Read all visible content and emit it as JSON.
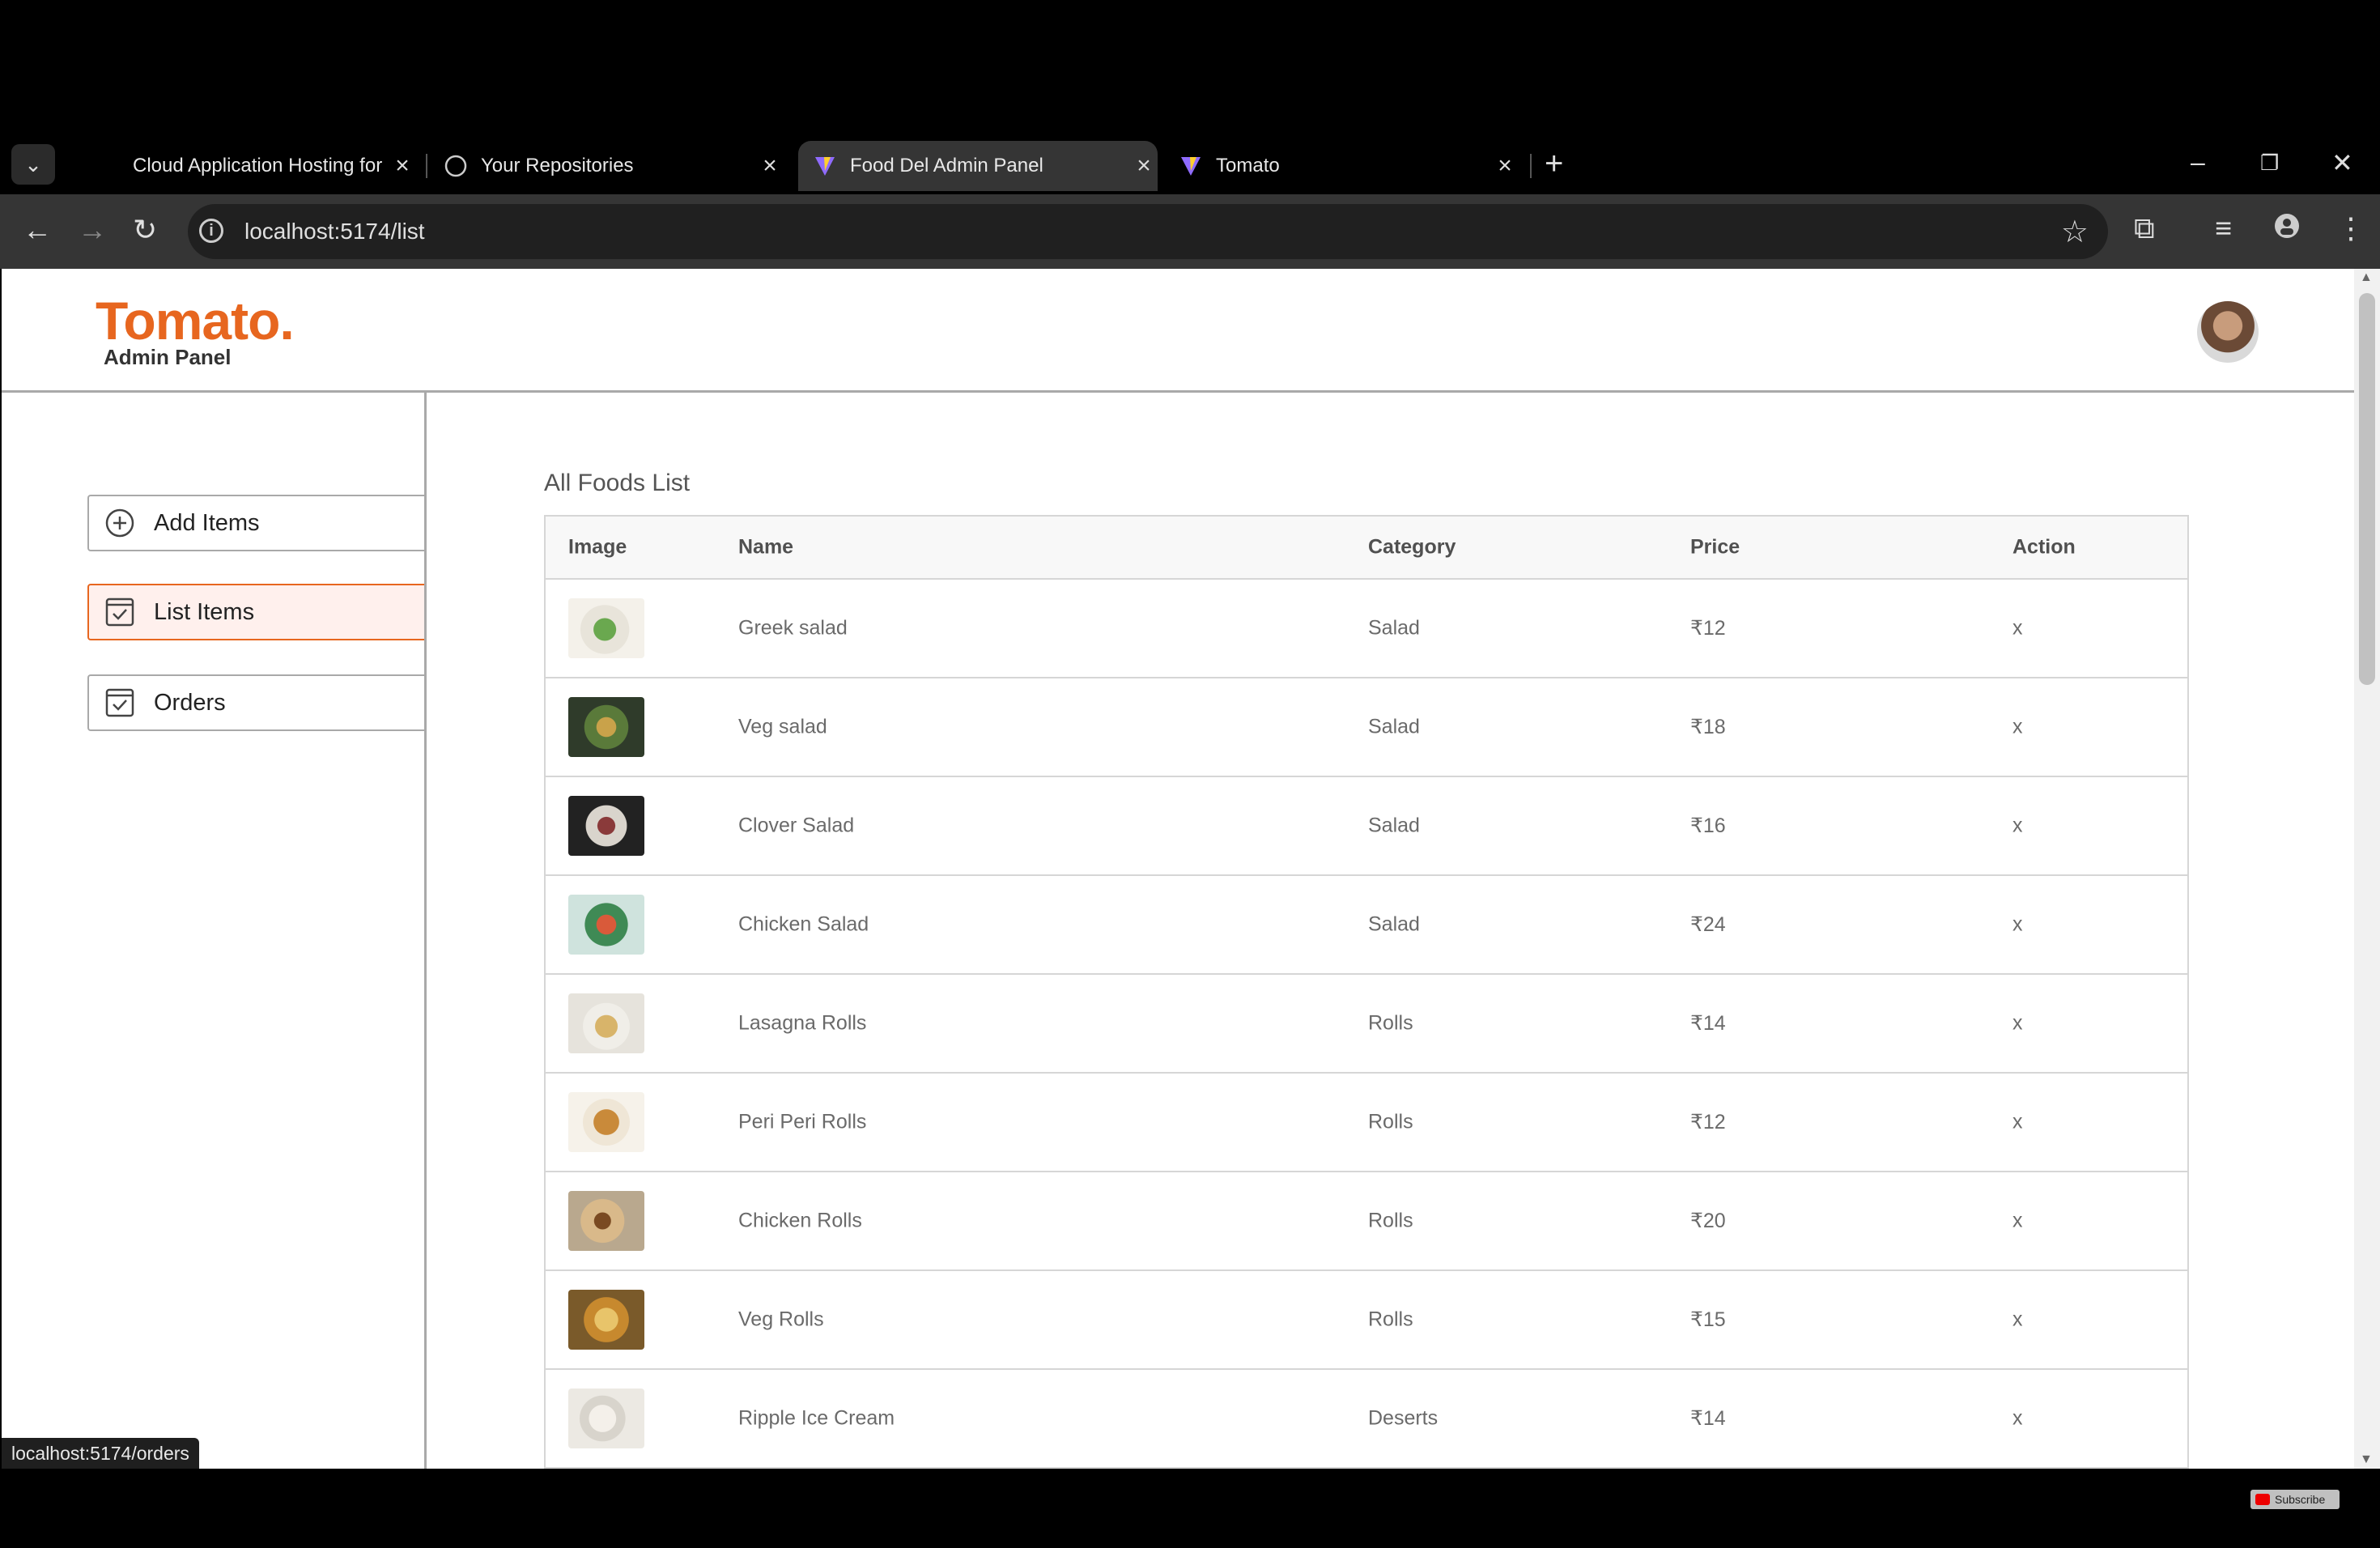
{
  "browser": {
    "tabs": [
      {
        "title": "Cloud Application Hosting for D",
        "icon": "cloud-icon",
        "active": false
      },
      {
        "title": "Your Repositories",
        "icon": "github-icon",
        "active": false
      },
      {
        "title": "Food Del Admin Panel",
        "icon": "vite-icon",
        "active": true
      },
      {
        "title": "Tomato",
        "icon": "vite-icon",
        "active": false
      }
    ],
    "url": "localhost:5174/list",
    "status_url": "localhost:5174/orders"
  },
  "header": {
    "logo": "Tomato.",
    "subtitle": "Admin Panel"
  },
  "sidebar": {
    "items": [
      {
        "label": "Add Items",
        "icon": "add-circle-icon",
        "active": false
      },
      {
        "label": "List Items",
        "icon": "checkbox-icon",
        "active": true
      },
      {
        "label": "Orders",
        "icon": "checkbox-icon",
        "active": false
      }
    ]
  },
  "main": {
    "title": "All Foods List",
    "columns": [
      "Image",
      "Name",
      "Category",
      "Price",
      "Action"
    ],
    "rows": [
      {
        "name": "Greek salad",
        "category": "Salad",
        "price": "₹12",
        "action": "x",
        "image": "greek-salad-image"
      },
      {
        "name": "Veg salad",
        "category": "Salad",
        "price": "₹18",
        "action": "x",
        "image": "veg-salad-image"
      },
      {
        "name": "Clover Salad",
        "category": "Salad",
        "price": "₹16",
        "action": "x",
        "image": "clover-salad-image"
      },
      {
        "name": "Chicken Salad",
        "category": "Salad",
        "price": "₹24",
        "action": "x",
        "image": "chicken-salad-image"
      },
      {
        "name": "Lasagna Rolls",
        "category": "Rolls",
        "price": "₹14",
        "action": "x",
        "image": "lasagna-rolls-image"
      },
      {
        "name": "Peri Peri Rolls",
        "category": "Rolls",
        "price": "₹12",
        "action": "x",
        "image": "peri-peri-rolls-image"
      },
      {
        "name": "Chicken Rolls",
        "category": "Rolls",
        "price": "₹20",
        "action": "x",
        "image": "chicken-rolls-image"
      },
      {
        "name": "Veg Rolls",
        "category": "Rolls",
        "price": "₹15",
        "action": "x",
        "image": "veg-rolls-image"
      },
      {
        "name": "Ripple Ice Cream",
        "category": "Deserts",
        "price": "₹14",
        "action": "x",
        "image": "ripple-ice-cream-image"
      }
    ]
  },
  "overlay": {
    "subscribe": "Subscribe"
  },
  "colors": {
    "brand": "#e7661f",
    "active_bg": "#fff0ed",
    "border": "#a9a9a9"
  }
}
